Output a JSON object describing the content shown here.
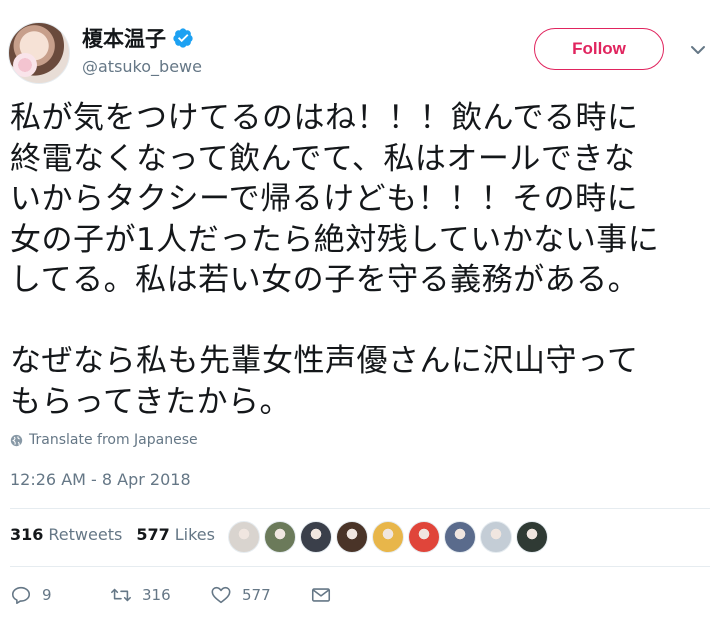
{
  "header": {
    "display_name": "榎本温子",
    "handle": "@atsuko_bewe",
    "follow_label": "Follow"
  },
  "tweet": {
    "text": "私が気をつけてるのはね！！！飲んでる時に\n終電なくなって飲んでて、私はオールできな\nいからタクシーで帰るけども！！！その時に\n女の子が1人だったら絶対残していかない事に\nしてる。私は若い女の子を守る義務がある。\n\nなぜなら私も先輩女性声優さんに沢山守って\nもらってきたから。",
    "translate_label": "Translate from Japanese",
    "timestamp": "12:26 AM - 8 Apr 2018"
  },
  "stats": {
    "retweets_count": "316",
    "retweets_label": "Retweets",
    "likes_count": "577",
    "likes_label": "Likes"
  },
  "actions": {
    "reply_count": "9",
    "retweet_count": "316",
    "like_count": "577"
  },
  "colors": {
    "accent": "#e0245e",
    "verified": "#1da1f2",
    "secondary_text": "#657786"
  },
  "likers": [
    {
      "color": "#d9d4cf"
    },
    {
      "color": "#6b7a5a"
    },
    {
      "color": "#3a3f4a"
    },
    {
      "color": "#4a3428"
    },
    {
      "color": "#e8b64a"
    },
    {
      "color": "#e0453a"
    },
    {
      "color": "#5a6b8c"
    },
    {
      "color": "#c4cdd6"
    },
    {
      "color": "#2f3a34"
    }
  ]
}
